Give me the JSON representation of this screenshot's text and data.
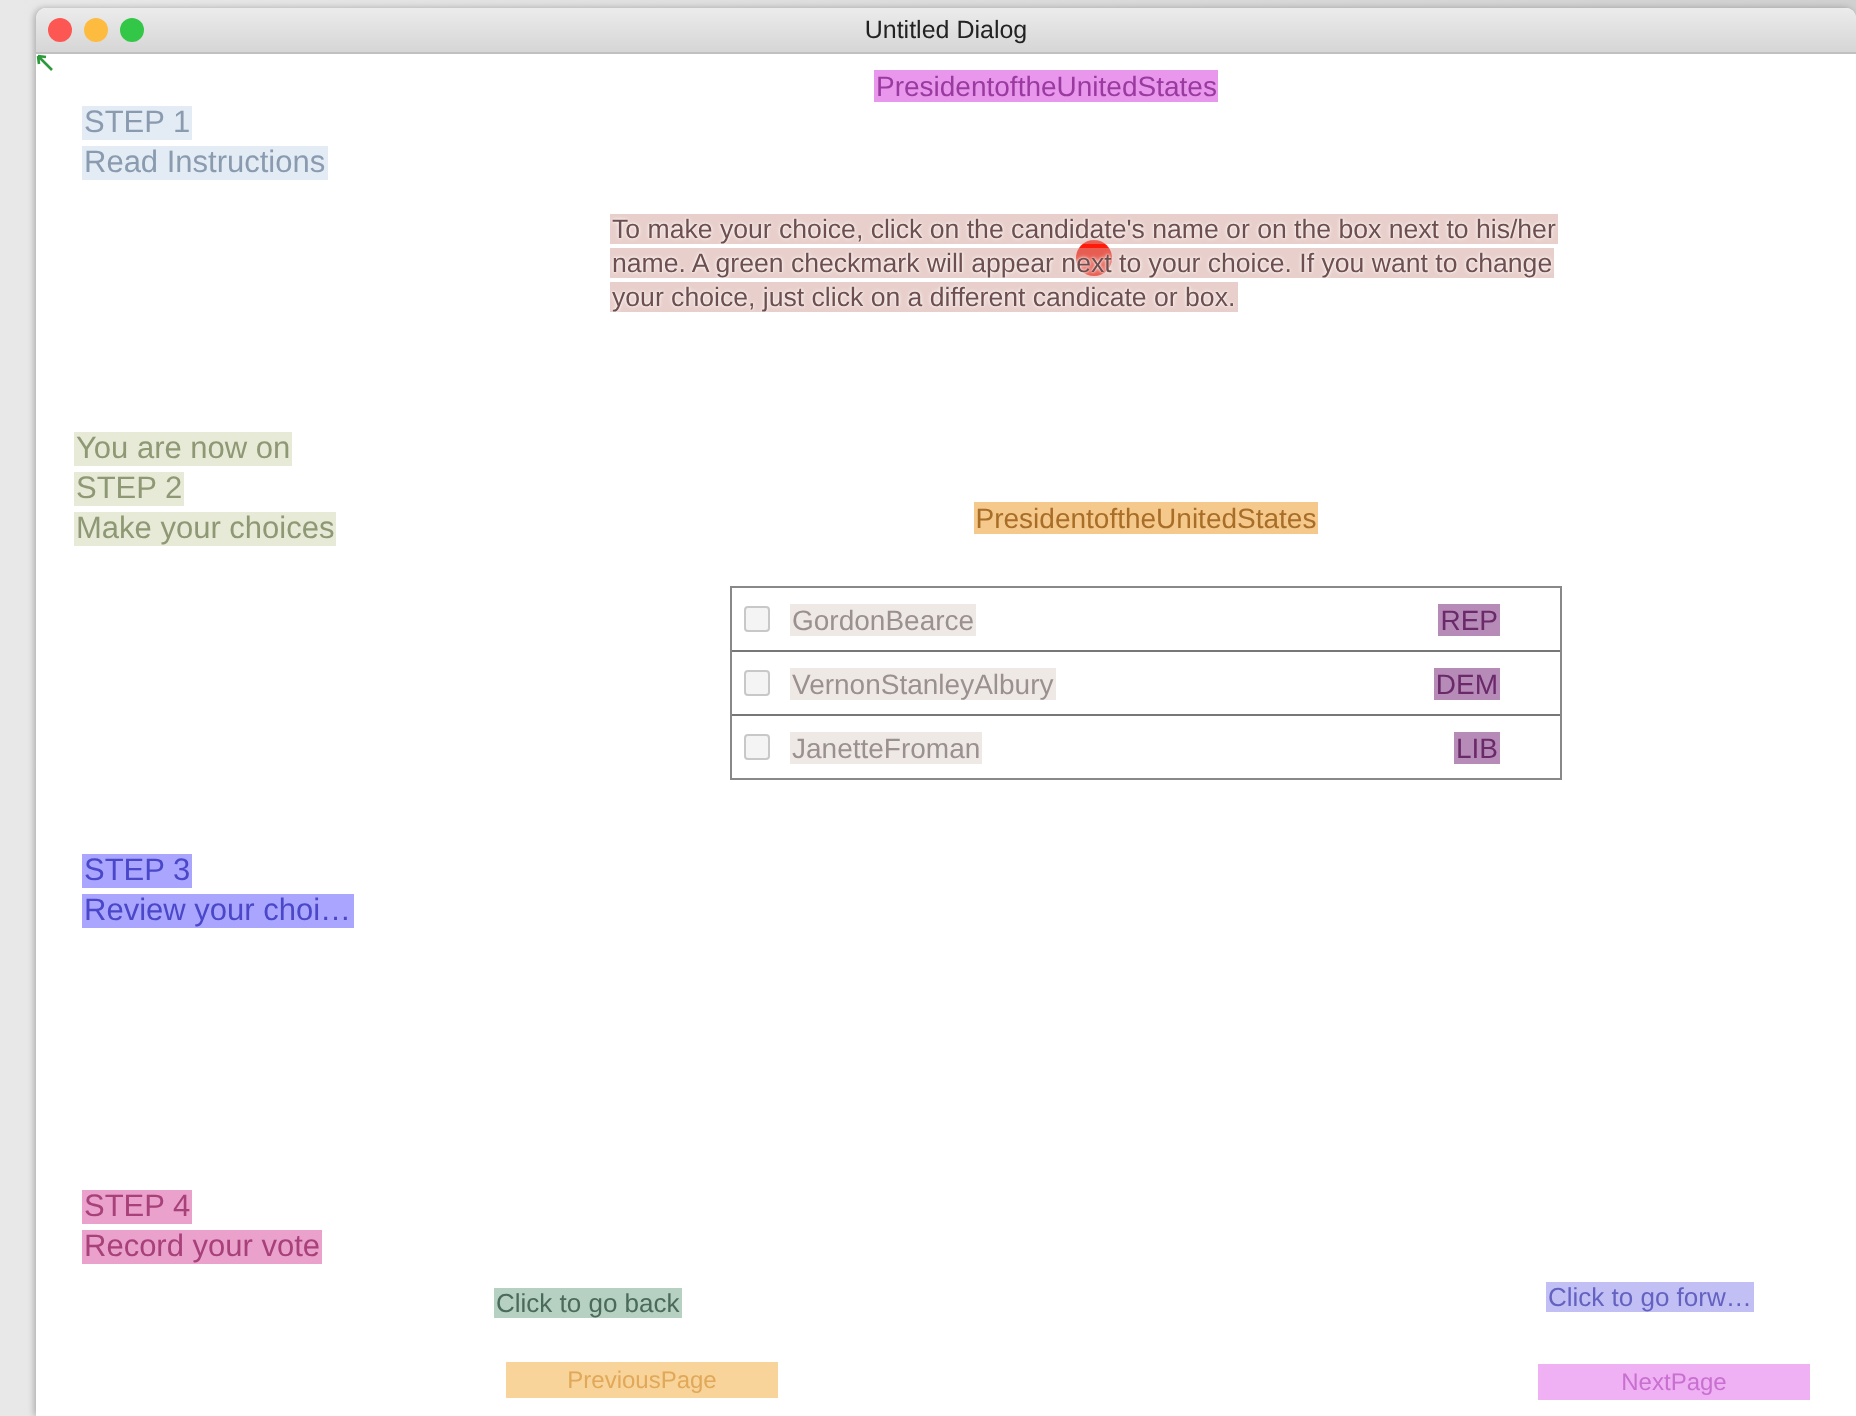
{
  "window": {
    "title": "Untitled Dialog"
  },
  "header": {
    "text": "PresidentoftheUnitedStates"
  },
  "steps": [
    {
      "lines": [
        "STEP 1",
        "Read Instructions"
      ],
      "color": "#e3ebf5"
    },
    {
      "lines": [
        "You are now on",
        "STEP 2",
        "Make your choices"
      ],
      "color": "#e6ead6"
    },
    {
      "lines": [
        "STEP 3",
        "Review your choi…"
      ],
      "color": "#aaa6ff"
    },
    {
      "lines": [
        "STEP 4",
        "Record your vote"
      ],
      "color": "#eaa2cc"
    }
  ],
  "instructions": "To make your choice, click on the candidate's name or on the box next to his/her name. A green checkmark will appear next to your choice. If you want to change your choice, just click on a different candicate or box.",
  "ballot": {
    "title": "PresidentoftheUnitedStates",
    "candidates": [
      {
        "name": "GordonBearce",
        "party": "REP",
        "checked": false
      },
      {
        "name": "VernonStanleyAlbury",
        "party": "DEM",
        "checked": false
      },
      {
        "name": "JanetteFroman",
        "party": "LIB",
        "checked": false
      }
    ]
  },
  "back": {
    "hint": "Click to go back",
    "button": "PreviousPage"
  },
  "forward": {
    "hint": "Click to go forw…",
    "button": "NextPage"
  }
}
